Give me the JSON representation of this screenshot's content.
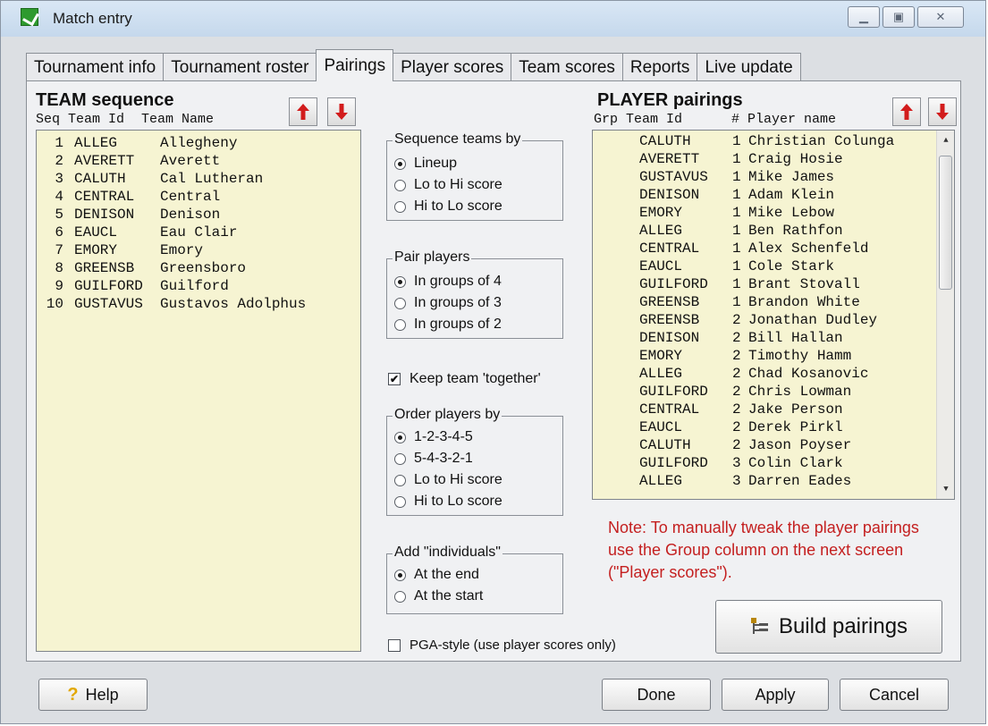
{
  "window": {
    "title": "Match entry",
    "controls": [
      "minimize",
      "maximize",
      "close"
    ]
  },
  "tabs": [
    {
      "label": "Tournament info",
      "active": false
    },
    {
      "label": "Tournament roster",
      "active": false
    },
    {
      "label": "Pairings",
      "active": true
    },
    {
      "label": "Player scores",
      "active": false
    },
    {
      "label": "Team scores",
      "active": false
    },
    {
      "label": "Reports",
      "active": false
    },
    {
      "label": "Live update",
      "active": false
    }
  ],
  "team_sequence": {
    "title": "TEAM sequence",
    "headers": [
      "Seq",
      "Team Id",
      "Team Name"
    ],
    "rows": [
      {
        "seq": "1",
        "team_id": "ALLEG",
        "team_name": "Allegheny"
      },
      {
        "seq": "2",
        "team_id": "AVERETT",
        "team_name": "Averett"
      },
      {
        "seq": "3",
        "team_id": "CALUTH",
        "team_name": "Cal Lutheran"
      },
      {
        "seq": "4",
        "team_id": "CENTRAL",
        "team_name": "Central"
      },
      {
        "seq": "5",
        "team_id": "DENISON",
        "team_name": "Denison"
      },
      {
        "seq": "6",
        "team_id": "EAUCL",
        "team_name": "Eau Clair"
      },
      {
        "seq": "7",
        "team_id": "EMORY",
        "team_name": "Emory"
      },
      {
        "seq": "8",
        "team_id": "GREENSB",
        "team_name": "Greensboro"
      },
      {
        "seq": "9",
        "team_id": "GUILFORD",
        "team_name": "Guilford"
      },
      {
        "seq": "10",
        "team_id": "GUSTAVUS",
        "team_name": "Gustavos Adolphus"
      }
    ]
  },
  "sequence_teams": {
    "legend": "Sequence teams by",
    "options": [
      {
        "label": "Lineup",
        "selected": true
      },
      {
        "label": "Lo to Hi score",
        "selected": false
      },
      {
        "label": "Hi to Lo score",
        "selected": false
      }
    ]
  },
  "pair_players": {
    "legend": "Pair players",
    "options": [
      {
        "label": "In groups of 4",
        "selected": true
      },
      {
        "label": "In groups of 3",
        "selected": false
      },
      {
        "label": "In groups of 2",
        "selected": false
      }
    ]
  },
  "keep_together": {
    "label": "Keep team 'together'",
    "checked": true
  },
  "order_players": {
    "legend": "Order players by",
    "options": [
      {
        "label": "1-2-3-4-5",
        "selected": true
      },
      {
        "label": "5-4-3-2-1",
        "selected": false
      },
      {
        "label": "Lo to Hi score",
        "selected": false
      },
      {
        "label": "Hi to Lo score",
        "selected": false
      }
    ]
  },
  "add_individuals": {
    "legend": "Add \"individuals\"",
    "options": [
      {
        "label": "At the end",
        "selected": true
      },
      {
        "label": "At the start",
        "selected": false
      }
    ]
  },
  "pga_style": {
    "label": "PGA-style (use player scores only)",
    "checked": false
  },
  "player_pairings": {
    "title": "PLAYER pairings",
    "headers": [
      "Grp",
      "Team Id",
      "#",
      "Player name"
    ],
    "rows": [
      {
        "grp": "",
        "team_id": "CALUTH",
        "num": "1",
        "player": "Christian Colunga"
      },
      {
        "grp": "",
        "team_id": "AVERETT",
        "num": "1",
        "player": "Craig Hosie"
      },
      {
        "grp": "",
        "team_id": "GUSTAVUS",
        "num": "1",
        "player": "Mike James"
      },
      {
        "grp": "",
        "team_id": "DENISON",
        "num": "1",
        "player": "Adam Klein"
      },
      {
        "grp": "",
        "team_id": "EMORY",
        "num": "1",
        "player": "Mike Lebow"
      },
      {
        "grp": "",
        "team_id": "ALLEG",
        "num": "1",
        "player": "Ben Rathfon"
      },
      {
        "grp": "",
        "team_id": "CENTRAL",
        "num": "1",
        "player": "Alex Schenfeld"
      },
      {
        "grp": "",
        "team_id": "EAUCL",
        "num": "1",
        "player": "Cole Stark"
      },
      {
        "grp": "",
        "team_id": "GUILFORD",
        "num": "1",
        "player": "Brant Stovall"
      },
      {
        "grp": "",
        "team_id": "GREENSB",
        "num": "1",
        "player": "Brandon White"
      },
      {
        "grp": "",
        "team_id": "GREENSB",
        "num": "2",
        "player": "Jonathan Dudley"
      },
      {
        "grp": "",
        "team_id": "DENISON",
        "num": "2",
        "player": "Bill Hallan"
      },
      {
        "grp": "",
        "team_id": "EMORY",
        "num": "2",
        "player": "Timothy Hamm"
      },
      {
        "grp": "",
        "team_id": "ALLEG",
        "num": "2",
        "player": "Chad Kosanovic"
      },
      {
        "grp": "",
        "team_id": "GUILFORD",
        "num": "2",
        "player": "Chris Lowman"
      },
      {
        "grp": "",
        "team_id": "CENTRAL",
        "num": "2",
        "player": "Jake Person"
      },
      {
        "grp": "",
        "team_id": "EAUCL",
        "num": "2",
        "player": "Derek Pirkl"
      },
      {
        "grp": "",
        "team_id": "CALUTH",
        "num": "2",
        "player": "Jason Poyser"
      },
      {
        "grp": "",
        "team_id": "GUILFORD",
        "num": "3",
        "player": "Colin Clark"
      },
      {
        "grp": "",
        "team_id": "ALLEG",
        "num": "3",
        "player": "Darren Eades"
      }
    ]
  },
  "note": "Note: To manually tweak the player pairings use the Group column on the next screen (\"Player scores\").",
  "build_button": "Build pairings",
  "footer": {
    "help": "Help",
    "done": "Done",
    "apply": "Apply",
    "cancel": "Cancel"
  },
  "colors": {
    "list_bg": "#f6f4d2",
    "note": "#c42020",
    "arrow": "#d21c1c",
    "panel": "#f0f1f3"
  }
}
